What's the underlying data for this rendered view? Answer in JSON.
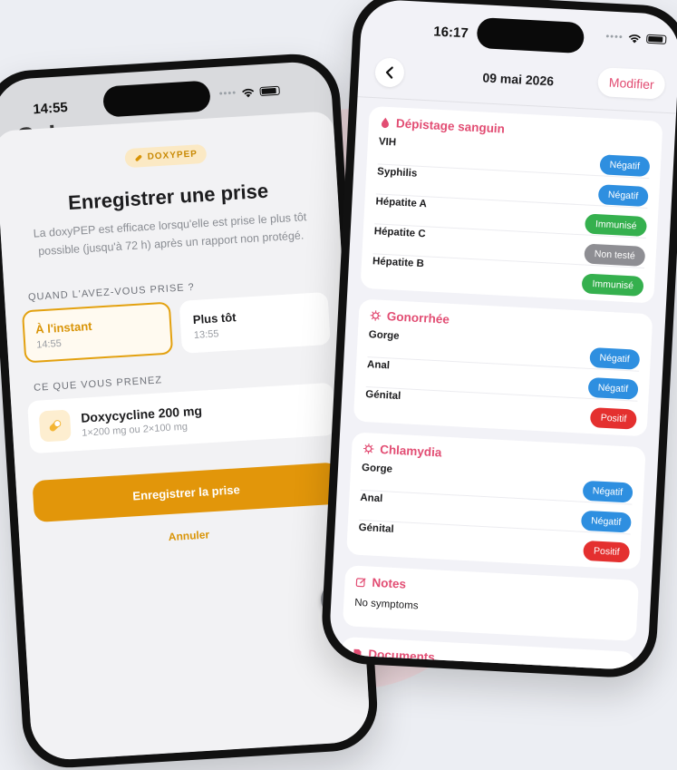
{
  "colors": {
    "brand_amber": "#e2960a",
    "brand_pink": "#e24d73",
    "status_negative": "#2e8fe0",
    "status_immune": "#35b04e",
    "status_untested": "#8e8e93",
    "status_positive": "#e4302f"
  },
  "left": {
    "status_time": "14:55",
    "bg_title": "Calen",
    "badge": {
      "icon": "pill-icon",
      "label": "DOXYPEP"
    },
    "title": "Enregistrer une prise",
    "description": "La doxyPEP est efficace lorsqu'elle est prise le plus tôt possible (jusqu'à 72 h) après un rapport non protégé.",
    "when_label": "QUAND L'AVEZ-VOUS PRISE ?",
    "options": [
      {
        "title": "À l'instant",
        "sub": "14:55",
        "selected": true
      },
      {
        "title": "Plus tôt",
        "sub": "13:55",
        "selected": false
      }
    ],
    "what_label": "CE QUE VOUS PRENEZ",
    "medication": {
      "icon": "pill-icon",
      "name": "Doxycycline 200 mg",
      "dose": "1×200 mg ou 2×100 mg"
    },
    "primary_button": "Enregistrer la prise",
    "cancel": "Annuler",
    "gear_icon": "gear-icon"
  },
  "right": {
    "status_time": "16:17",
    "nav": {
      "back_icon": "chevron-left-icon",
      "title": "09 mai 2026",
      "edit": "Modifier"
    },
    "sections": [
      {
        "title": "Dépistage sanguin",
        "icon": "drop-icon",
        "tests": [
          {
            "name": "VIH",
            "result": "Négatif",
            "status": "negative"
          },
          {
            "name": "Syphilis",
            "result": "Négatif",
            "status": "negative"
          },
          {
            "name": "Hépatite A",
            "result": "Immunisé",
            "status": "immune"
          },
          {
            "name": "Hépatite C",
            "result": "Non testé",
            "status": "untested"
          },
          {
            "name": "Hépatite B",
            "result": "Immunisé",
            "status": "immune"
          }
        ]
      },
      {
        "title": "Gonorrhée",
        "icon": "bacteria-icon",
        "tests": [
          {
            "name": "Gorge",
            "result": "Négatif",
            "status": "negative"
          },
          {
            "name": "Anal",
            "result": "Négatif",
            "status": "negative"
          },
          {
            "name": "Génital",
            "result": "Positif",
            "status": "positive"
          }
        ]
      },
      {
        "title": "Chlamydia",
        "icon": "bacteria-icon",
        "tests": [
          {
            "name": "Gorge",
            "result": "Négatif",
            "status": "negative"
          },
          {
            "name": "Anal",
            "result": "Négatif",
            "status": "negative"
          },
          {
            "name": "Génital",
            "result": "Positif",
            "status": "positive"
          }
        ]
      }
    ],
    "notes": {
      "title": "Notes",
      "icon": "edit-icon",
      "text": "No symptoms"
    },
    "documents": {
      "title": "Documents",
      "icon": "document-icon"
    }
  }
}
